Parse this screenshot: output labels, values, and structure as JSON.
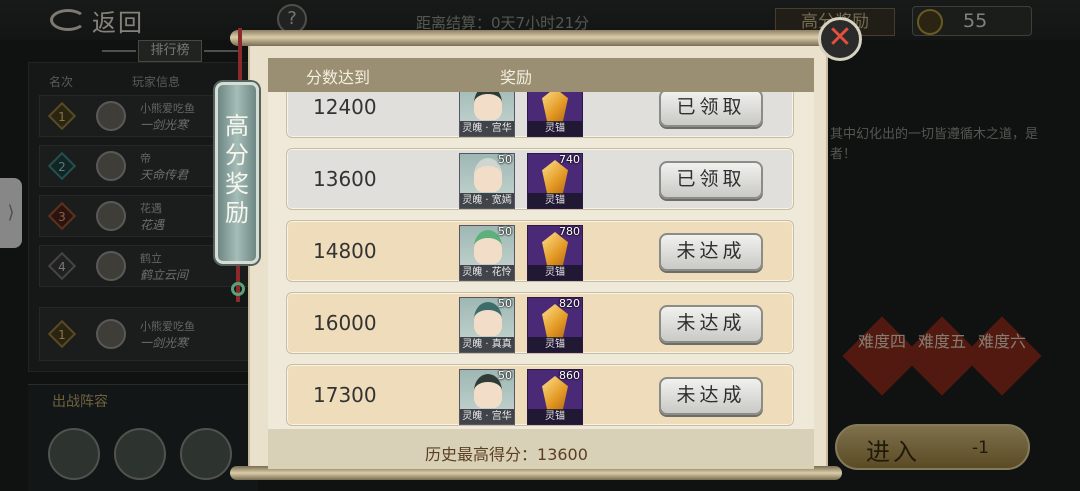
{
  "background": {
    "back_label": "返回",
    "help_label": "?",
    "countdown": "距离结算：0天7小时21分",
    "top_tab": "高分奖励",
    "energy_value": "55",
    "rank_tab": "排行榜",
    "col_rank": "名次",
    "col_player": "玩家信息",
    "rank_rows": [
      {
        "rank": "1",
        "name": "小熊爱吃鱼",
        "sign": "一剑光寒"
      },
      {
        "rank": "2",
        "name": "帝",
        "sign": "天命传君"
      },
      {
        "rank": "3",
        "name": "花遇",
        "sign": "花遇"
      },
      {
        "rank": "4",
        "name": "鹤立",
        "sign": "鹤立云间"
      },
      {
        "rank": "1",
        "name": "小熊爱吃鱼",
        "sign": "一剑光寒"
      }
    ],
    "team_title": "出战阵容",
    "desc_text": "其中幻化出的一切皆遵循木之道，是者！",
    "difficulties": [
      "难度四",
      "难度五",
      "难度六"
    ],
    "enter_label": "进入",
    "enter_cost": "-1"
  },
  "modal": {
    "banner_title": "高分奖励",
    "close_icon": "close-x-icon",
    "header_score": "分数达到",
    "header_reward": "奖励",
    "rows": [
      {
        "score": "12400",
        "soul_name": "灵魄 · 宫华",
        "soul_count": "",
        "crystal_name": "灵锚",
        "crystal_count": "",
        "status": "已领取",
        "state": "claimed"
      },
      {
        "score": "13600",
        "soul_name": "灵魄 · 宽嫣",
        "soul_count": "50",
        "crystal_name": "灵锚",
        "crystal_count": "740",
        "status": "已领取",
        "state": "claimed"
      },
      {
        "score": "14800",
        "soul_name": "灵魄 · 花怜",
        "soul_count": "50",
        "crystal_name": "灵锚",
        "crystal_count": "780",
        "status": "未达成",
        "state": "pending"
      },
      {
        "score": "16000",
        "soul_name": "灵魄 · 真真",
        "soul_count": "50",
        "crystal_name": "灵锚",
        "crystal_count": "820",
        "status": "未达成",
        "state": "pending"
      },
      {
        "score": "17300",
        "soul_name": "灵魄 · 宫华",
        "soul_count": "50",
        "crystal_name": "灵锚",
        "crystal_count": "860",
        "status": "未达成",
        "state": "pending"
      }
    ],
    "footer_label": "历史最高得分：",
    "footer_value": "13600"
  }
}
